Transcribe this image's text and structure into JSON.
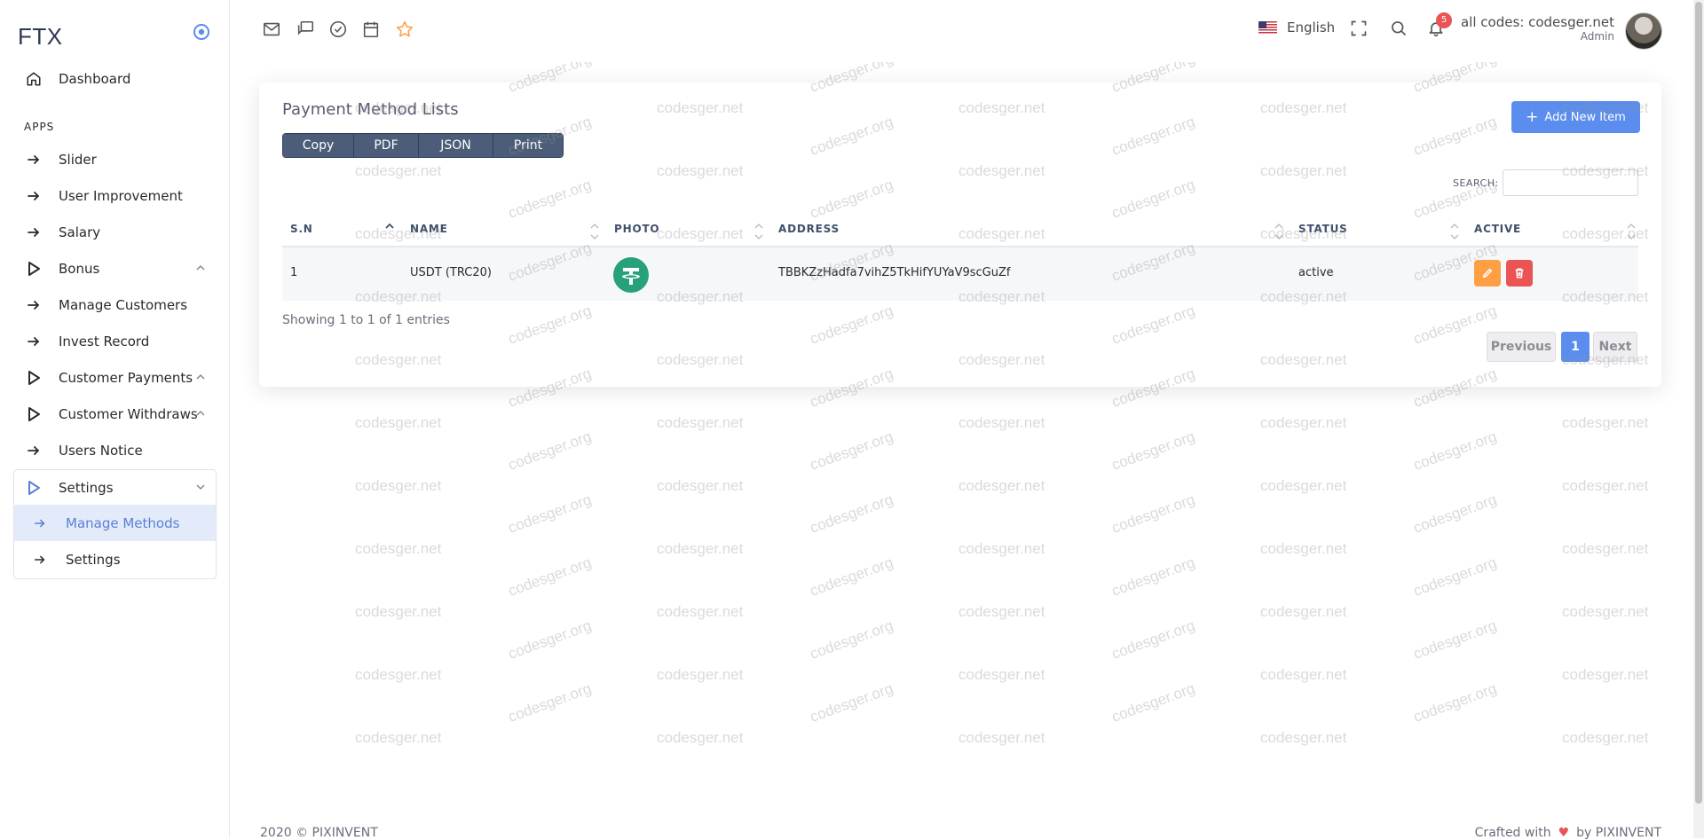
{
  "brand": {
    "name": "FTX"
  },
  "sidebar": {
    "dashboard": "Dashboard",
    "apps_header": "APPS",
    "items": [
      {
        "label": "Slider"
      },
      {
        "label": "User Improvement"
      },
      {
        "label": "Salary"
      },
      {
        "label": "Bonus"
      },
      {
        "label": "Manage Customers"
      },
      {
        "label": "Invest Record"
      },
      {
        "label": "Customer Payments"
      },
      {
        "label": "Customer Withdraws"
      },
      {
        "label": "Users Notice"
      },
      {
        "label": "Settings"
      }
    ],
    "sub_items": [
      {
        "label": "Manage Methods"
      },
      {
        "label": "Settings"
      }
    ]
  },
  "topbar": {
    "language": "English",
    "notification_count": "5",
    "user_name": "all codes: codesger.net",
    "user_role": "Admin"
  },
  "card": {
    "title": "Payment Method Lists",
    "export_buttons": [
      "Copy",
      "PDF",
      "JSON",
      "Print"
    ],
    "add_button": "Add New Item",
    "search_label": "SEARCH:",
    "search_value": "",
    "columns": [
      "S.N",
      "NAME",
      "PHOTO",
      "ADDRESS",
      "STATUS",
      "ACTIVE"
    ],
    "rows": [
      {
        "sn": "1",
        "name": "USDT (TRC20)",
        "address": "TBBKZzHadfa7vihZ5TkHifYUYaV9scGuZf",
        "status": "active"
      }
    ],
    "info": "Showing 1 to 1 of 1 entries",
    "pagination": {
      "prev": "Previous",
      "page": "1",
      "next": "Next"
    }
  },
  "watermarks": [
    "codesger.net",
    "codesger.org"
  ],
  "footer": {
    "left": "2020 © PIXINVENT",
    "crafted": "Crafted with",
    "by": "by PIXINVENT"
  },
  "colors": {
    "primary": "#5a8dee",
    "warning": "#ff9f43",
    "danger": "#ea5455",
    "tether": "#26a17b",
    "export_btn": "#4b5d78"
  }
}
